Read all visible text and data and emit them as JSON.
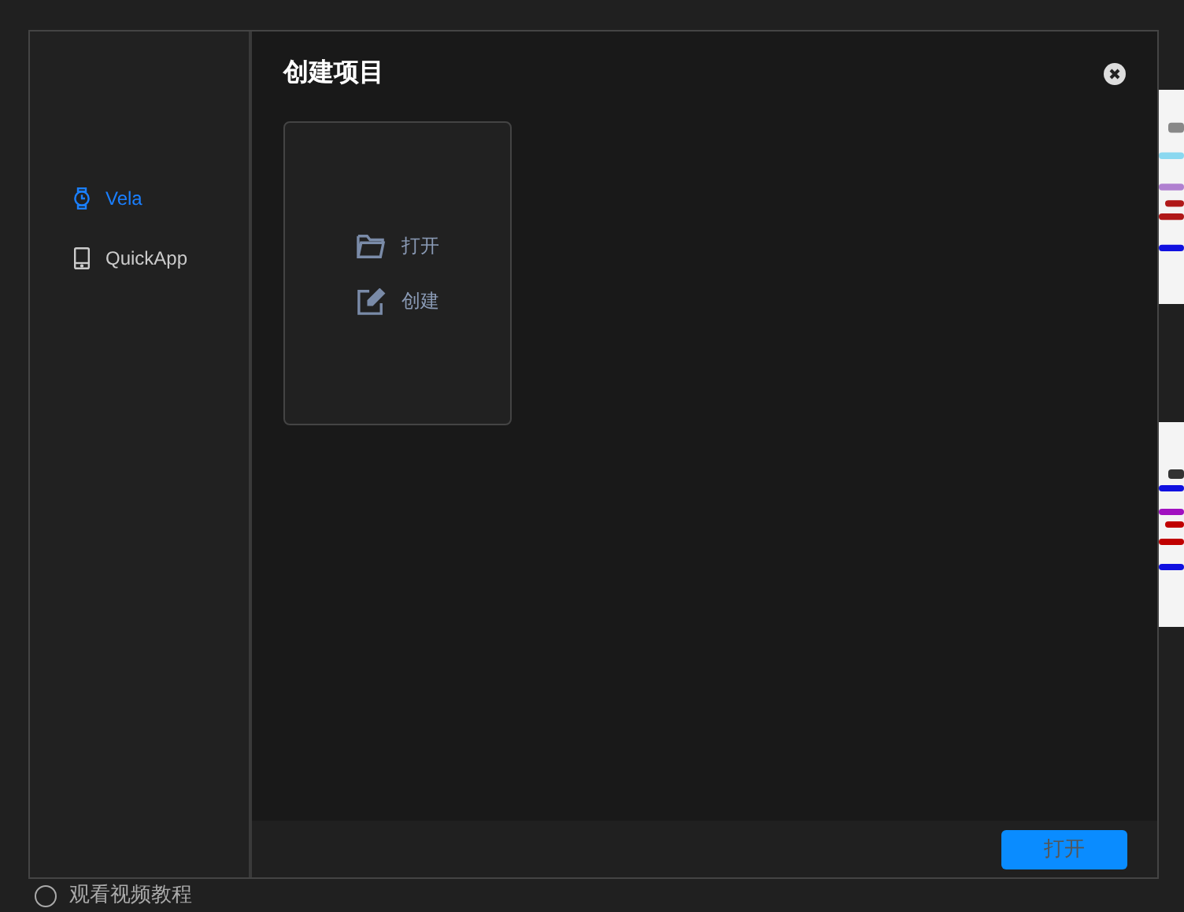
{
  "background": {
    "tutorial": {
      "label": "观看视频教程",
      "checked": false
    }
  },
  "dialog": {
    "title": "创建项目",
    "sidebar": [
      {
        "label": "Vela",
        "selected": true
      },
      {
        "label": "QuickApp",
        "selected": false
      }
    ],
    "options": [
      {
        "label": "打开"
      },
      {
        "label": "创建"
      }
    ],
    "button": {
      "label": "打开",
      "disabled": true
    }
  }
}
